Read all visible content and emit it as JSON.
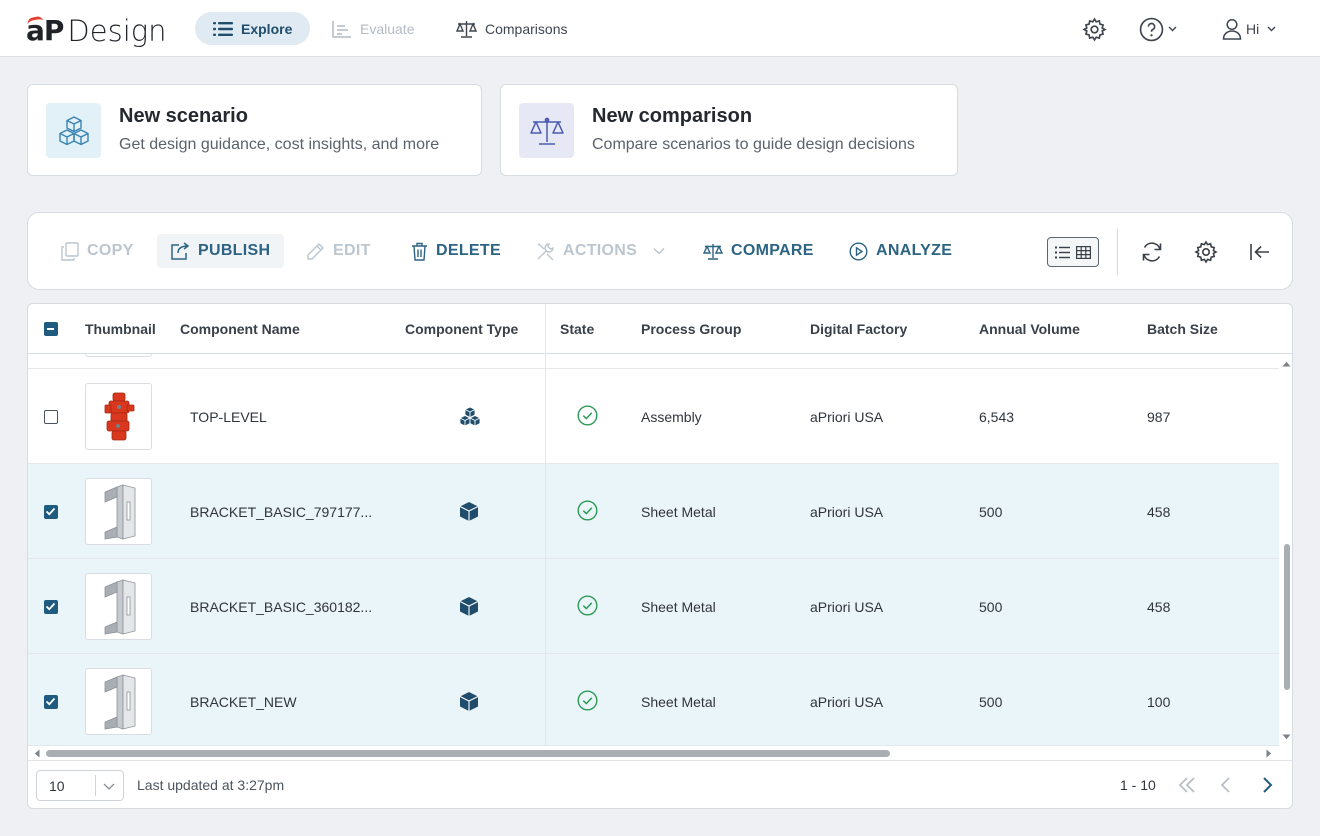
{
  "app": {
    "brand_mark": "aP",
    "brand_name": "Design",
    "nav": [
      {
        "label": "Explore",
        "state": "active"
      },
      {
        "label": "Evaluate",
        "state": "disabled"
      },
      {
        "label": "Comparisons",
        "state": "normal"
      }
    ],
    "user_label": "Hi"
  },
  "cards": [
    {
      "title": "New scenario",
      "subtitle": "Get design guidance, cost insights, and more",
      "icon": "cubes-icon"
    },
    {
      "title": "New comparison",
      "subtitle": "Compare scenarios to guide design decisions",
      "icon": "scales-icon"
    }
  ],
  "toolbar": {
    "copy": "COPY",
    "publish": "PUBLISH",
    "edit": "EDIT",
    "delete": "DELETE",
    "actions": "ACTIONS",
    "compare": "COMPARE",
    "analyze": "ANALYZE"
  },
  "table": {
    "columns": [
      "Thumbnail",
      "Component Name",
      "Component Type",
      "State",
      "Process Group",
      "Digital Factory",
      "Annual Volume",
      "Batch Size"
    ],
    "rows": [
      {
        "selected": false,
        "thumb": "assembly-thumbnail",
        "name": "TOP-LEVEL",
        "type": "assembly-icon",
        "state": "check-circle-icon",
        "process_group": "Assembly",
        "digital_factory": "aPriori USA",
        "annual_volume": "6,543",
        "batch_size": "987"
      },
      {
        "selected": true,
        "thumb": "bracket-thumbnail",
        "name": "BRACKET_BASIC_797177...",
        "type": "part-icon",
        "state": "check-circle-icon",
        "process_group": "Sheet Metal",
        "digital_factory": "aPriori USA",
        "annual_volume": "500",
        "batch_size": "458"
      },
      {
        "selected": true,
        "thumb": "bracket-thumbnail",
        "name": "BRACKET_BASIC_360182...",
        "type": "part-icon",
        "state": "check-circle-icon",
        "process_group": "Sheet Metal",
        "digital_factory": "aPriori USA",
        "annual_volume": "500",
        "batch_size": "458"
      },
      {
        "selected": true,
        "thumb": "bracket-thumbnail",
        "name": "BRACKET_NEW",
        "type": "part-icon",
        "state": "check-circle-icon",
        "process_group": "Sheet Metal",
        "digital_factory": "aPriori USA",
        "annual_volume": "500",
        "batch_size": "100"
      }
    ]
  },
  "footer": {
    "page_size": "10",
    "last_updated": "Last updated at 3:27pm",
    "range": "1 - 10"
  },
  "colors": {
    "accent": "#2d6383",
    "selected_row": "#eaf5f9",
    "check_green": "#2e9b57"
  }
}
